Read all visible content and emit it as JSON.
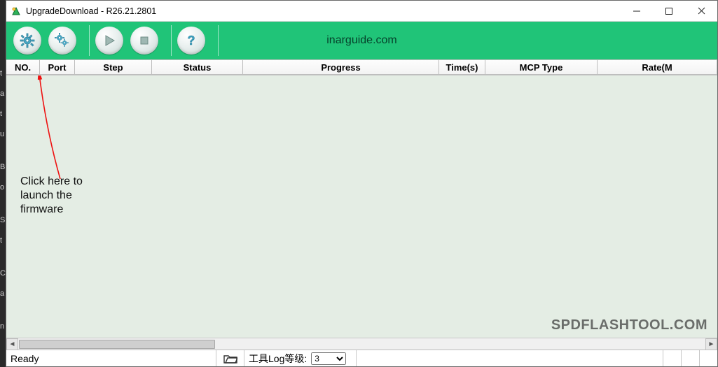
{
  "window": {
    "title": "UpgradeDownload - R26.21.2801"
  },
  "toolbar": {
    "brand_text": "inarguide.com",
    "buttons": {
      "settings": "settings",
      "settings2": "multi-settings",
      "play": "start",
      "stop": "stop",
      "help": "help"
    }
  },
  "columns": {
    "no": "NO.",
    "port": "Port",
    "step": "Step",
    "status": "Status",
    "progress": "Progress",
    "time": "Time(s)",
    "mcp": "MCP Type",
    "rate": "Rate(M"
  },
  "annotation": "Click here to\nlaunch the\nfirmware",
  "watermark": "SPDFLASHTOOL.COM",
  "statusbar": {
    "ready": "Ready",
    "log_label": "工具Log等级:",
    "log_value": "3"
  }
}
